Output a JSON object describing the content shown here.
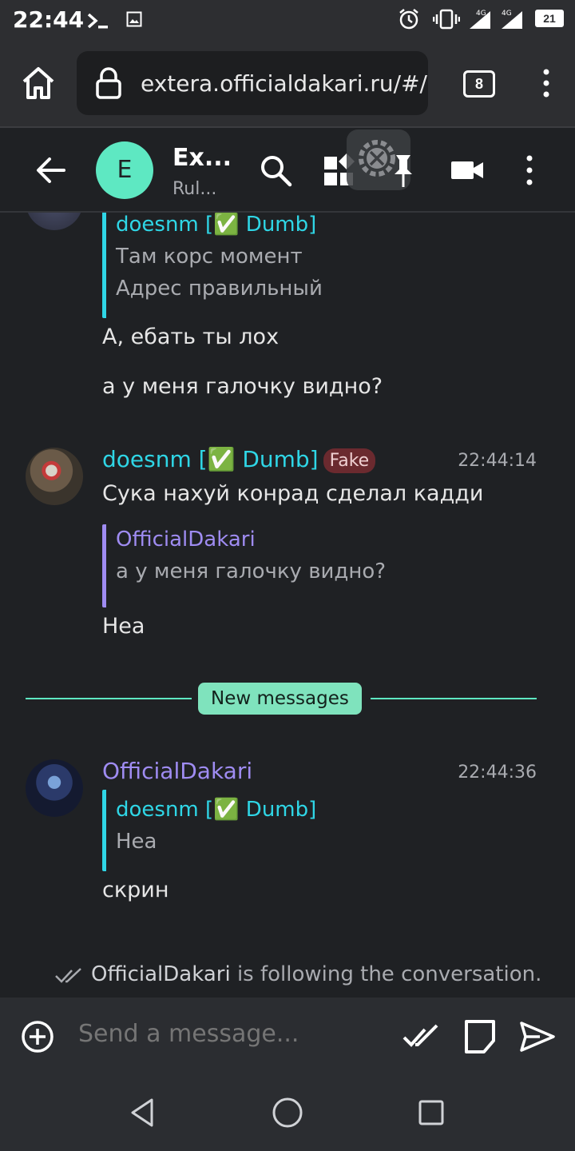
{
  "status_bar": {
    "time": "22:44",
    "battery": "21",
    "network": [
      "4G",
      "4G"
    ]
  },
  "browser": {
    "url": "extera.officialdakari.ru/#/ho",
    "tab_count": "8"
  },
  "room": {
    "avatar_letter": "E",
    "title": "Ex...",
    "subtitle": "Rul..."
  },
  "messages": [
    {
      "id": "m1",
      "quote": {
        "sender": "doesnm [✅ Dumb]",
        "lines": [
          "Там корс момент",
          "Адрес правильный"
        ]
      },
      "lines": [
        "А, ебать ты лох",
        "а у меня галочку видно?"
      ]
    },
    {
      "id": "m2",
      "sender": "doesnm [✅ Dumb]",
      "badge": "Fake",
      "time": "22:44:14",
      "line1": "Сука нахуй конрад сделал кадди",
      "quote": {
        "sender": "OfficialDakari",
        "lines": [
          "а у меня галочку видно?"
        ]
      },
      "line2": "Неа"
    },
    {
      "id": "m3",
      "sender": "OfficialDakari",
      "time": "22:44:36",
      "quote": {
        "sender": "doesnm [✅ Dumb]",
        "lines": [
          "Неа"
        ]
      },
      "line1": "скрин"
    }
  ],
  "divider": {
    "label": "New messages"
  },
  "read_receipt": {
    "user": "OfficialDakari",
    "text": " is following the conversation."
  },
  "composer": {
    "placeholder": "Send a message..."
  },
  "colors": {
    "accent": "#5ee8c2",
    "teal_sender": "#2fd6e6",
    "purple_sender": "#9f8cf2",
    "badge_bg": "#6b2a2f"
  },
  "icons": [
    "terminal-icon",
    "image-icon",
    "alarm-icon",
    "vibrate-icon",
    "signal-icon",
    "battery-icon",
    "home-icon",
    "lock-icon",
    "kebab-icon",
    "back-arrow-icon",
    "search-icon",
    "widgets-icon",
    "pin-icon",
    "video-call-icon",
    "add-icon",
    "read-icon",
    "sticker-icon",
    "send-icon",
    "nav-back-icon",
    "nav-home-icon",
    "nav-recents-icon"
  ]
}
